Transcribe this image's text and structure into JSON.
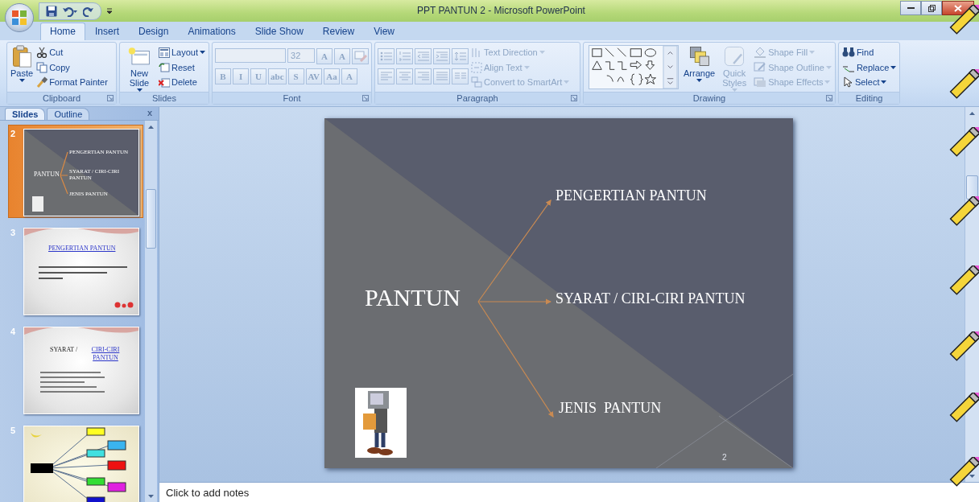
{
  "window": {
    "title": "PPT PANTUN 2 - Microsoft PowerPoint"
  },
  "tabs": [
    {
      "label": "Home",
      "selected": true
    },
    {
      "label": "Insert",
      "selected": false
    },
    {
      "label": "Design",
      "selected": false
    },
    {
      "label": "Animations",
      "selected": false
    },
    {
      "label": "Slide Show",
      "selected": false
    },
    {
      "label": "Review",
      "selected": false
    },
    {
      "label": "View",
      "selected": false
    }
  ],
  "ribbon": {
    "groups": [
      {
        "label": "Clipboard",
        "launcher": true,
        "columns": [
          [
            {
              "kind": "large",
              "label": "Paste",
              "dropdown": true,
              "disabled": false
            }
          ],
          [
            {
              "kind": "small",
              "label": "Cut",
              "dropdown": false,
              "disabled": false
            },
            {
              "kind": "small",
              "label": "Copy",
              "dropdown": false,
              "disabled": false
            },
            {
              "kind": "small",
              "label": "Format Painter",
              "dropdown": false,
              "disabled": false
            }
          ]
        ]
      },
      {
        "label": "Slides",
        "columns": [
          [
            {
              "kind": "large",
              "label": "New Slide",
              "dropdown": true,
              "disabled": false
            }
          ],
          [
            {
              "kind": "small",
              "label": "Layout",
              "dropdown": true,
              "disabled": false
            },
            {
              "kind": "small",
              "label": "Reset",
              "dropdown": false,
              "disabled": false
            },
            {
              "kind": "small",
              "label": "Delete",
              "dropdown": false,
              "disabled": false
            }
          ]
        ]
      },
      {
        "label": "Font",
        "launcher": true,
        "toolbar_rows": [
          {
            "controls": [
              {
                "kind": "font_field",
                "disabled": true
              },
              {
                "kind": "size_field",
                "value": "32",
                "disabled": true
              },
              {
                "kind": "glyph",
                "label": "A",
                "disabled": true
              },
              {
                "kind": "glyph",
                "label": "A",
                "disabled": true
              },
              {
                "kind": "icon",
                "disabled": true
              }
            ]
          },
          {
            "controls": [
              {
                "kind": "glyph",
                "label": "B",
                "disabled": true
              },
              {
                "kind": "glyph",
                "label": "I",
                "disabled": true
              },
              {
                "kind": "glyph",
                "label": "U",
                "disabled": true
              },
              {
                "kind": "glyph",
                "label": "abc",
                "disabled": true
              },
              {
                "kind": "glyph",
                "label": "S",
                "disabled": true
              },
              {
                "kind": "glyph",
                "label": "AV",
                "disabled": true
              },
              {
                "kind": "glyph",
                "label": "Aa",
                "disabled": true
              },
              {
                "kind": "glyph",
                "label": "A",
                "disabled": true
              }
            ]
          }
        ]
      },
      {
        "label": "Paragraph",
        "launcher": true,
        "toolbar_rows": [
          {
            "controls": [
              {
                "kind": "icon",
                "disabled": true
              },
              {
                "kind": "icon",
                "disabled": true
              },
              {
                "kind": "icon",
                "disabled": true
              },
              {
                "kind": "icon",
                "disabled": true
              },
              {
                "kind": "icon",
                "disabled": true
              }
            ]
          },
          {
            "controls": [
              {
                "kind": "icon",
                "disabled": true
              },
              {
                "kind": "icon",
                "disabled": true
              },
              {
                "kind": "icon",
                "disabled": true
              },
              {
                "kind": "icon",
                "disabled": true
              },
              {
                "kind": "icon",
                "disabled": true
              }
            ]
          }
        ],
        "columns": [
          [
            {
              "kind": "small",
              "label": "Text Direction",
              "dropdown": true,
              "disabled": true
            },
            {
              "kind": "small",
              "label": "Align Text",
              "dropdown": true,
              "disabled": true
            },
            {
              "kind": "small",
              "label": "Convert to SmartArt",
              "dropdown": true,
              "disabled": true
            }
          ]
        ]
      },
      {
        "label": "Drawing",
        "launcher": true,
        "columns": [
          [
            {
              "kind": "gallery",
              "disabled": false
            }
          ],
          [
            {
              "kind": "large",
              "label": "Arrange",
              "dropdown": true,
              "disabled": false
            }
          ],
          [
            {
              "kind": "large",
              "label": "Quick Styles",
              "dropdown": true,
              "disabled": true
            }
          ],
          [
            {
              "kind": "small",
              "label": "Shape Fill",
              "dropdown": true,
              "disabled": true
            },
            {
              "kind": "small",
              "label": "Shape Outline",
              "dropdown": true,
              "disabled": true
            },
            {
              "kind": "small",
              "label": "Shape Effects",
              "dropdown": true,
              "disabled": true
            }
          ]
        ]
      },
      {
        "label": "Editing",
        "columns": [
          [
            {
              "kind": "small",
              "label": "Find",
              "dropdown": false,
              "disabled": false
            },
            {
              "kind": "small",
              "label": "Replace",
              "dropdown": true,
              "disabled": false
            },
            {
              "kind": "small",
              "label": "Select",
              "dropdown": true,
              "disabled": false
            }
          ]
        ]
      }
    ]
  },
  "panel": {
    "tabs": [
      {
        "label": "Slides",
        "selected": true
      },
      {
        "label": "Outline",
        "selected": false
      }
    ],
    "close": "x",
    "thumbnails": [
      {
        "number": "2",
        "selected": true,
        "kind": "diagram",
        "title": "PANTUN",
        "items": [
          "PENGERTIAN PANTUN",
          "SYARAT / CIRI-CIRI PANTUN",
          "JENIS PANTUN"
        ]
      },
      {
        "number": "3",
        "selected": false,
        "kind": "text",
        "title": "PENGERTIAN PANTUN"
      },
      {
        "number": "4",
        "selected": false,
        "kind": "list",
        "title": "SYARAT / ",
        "title_link": "CIRI-CIRI PANTUN"
      },
      {
        "number": "5",
        "selected": false,
        "kind": "mindmap"
      }
    ]
  },
  "slide": {
    "title": "PANTUN",
    "branches": [
      "PENGERTIAN PANTUN",
      "SYARAT / CIRI-CIRI PANTUN",
      "JENIS  PANTUN"
    ],
    "page_number": "2"
  },
  "notes": {
    "placeholder": "Click to add notes"
  }
}
